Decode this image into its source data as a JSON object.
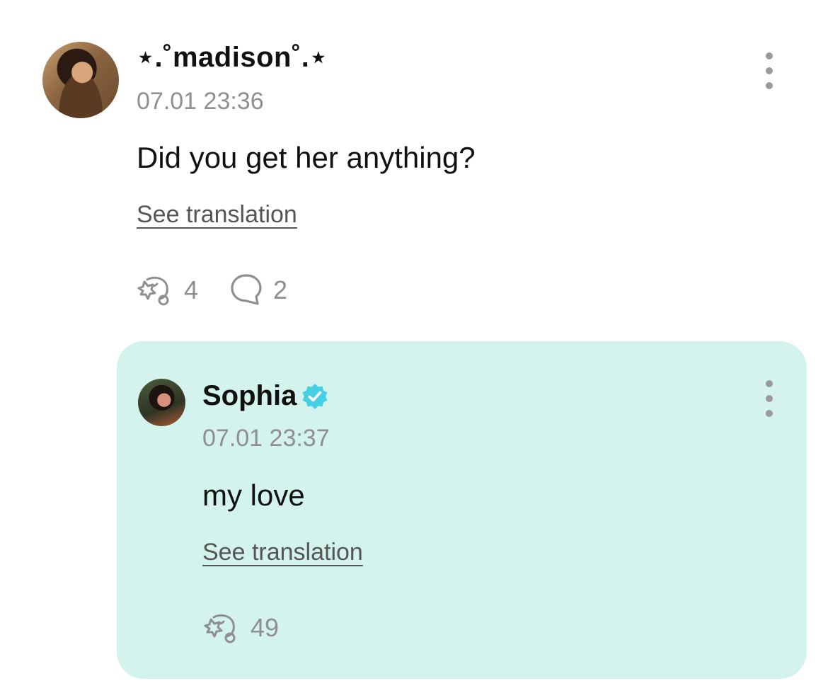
{
  "comment": {
    "username": "⋆.˚madison˚.⋆",
    "timestamp": "07.01 23:36",
    "text": "Did you get her anything?",
    "see_translation": "See translation",
    "reaction_count": "4",
    "reply_count": "2"
  },
  "reply": {
    "username": "Sophia",
    "verified": true,
    "timestamp": "07.01 23:37",
    "text": "my love",
    "see_translation": "See translation",
    "reaction_count": "49"
  },
  "colors": {
    "reply_background": "#d4f3ed",
    "verified_badge": "#45d0e6",
    "muted_text": "#8e8e93"
  },
  "icons": {
    "reaction": "reaction-icon",
    "comment": "comment-bubble-icon",
    "more": "more-vertical-icon",
    "verified": "verified-badge-icon"
  }
}
